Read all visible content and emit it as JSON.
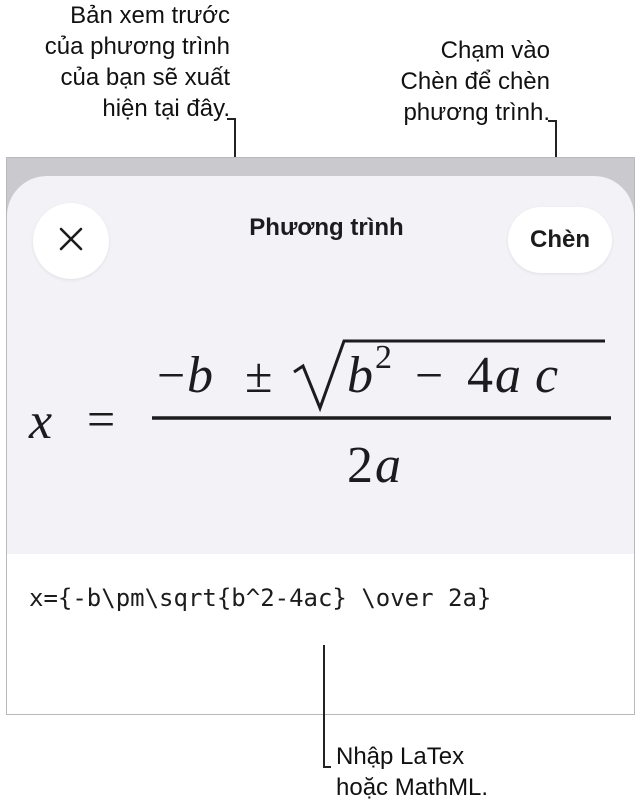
{
  "callouts": {
    "preview_lines": [
      "Bản xem trước",
      "của phương trình",
      "của bạn sẽ xuất",
      "hiện tại đây."
    ],
    "insert_lines": [
      "Chạm vào",
      "Chèn để chèn",
      "phương trình."
    ],
    "input_lines": [
      "Nhập LaTex",
      "hoặc MathML."
    ]
  },
  "sheet": {
    "title": "Phương trình",
    "close_icon": "xmark",
    "insert_label": "Chèn"
  },
  "formula": {
    "lhs": "x",
    "equals": "=",
    "minus": "−",
    "b": "b",
    "plusminus": "±",
    "b_sq": "b",
    "exponent": "2",
    "minus2": "−",
    "four_a_c": "4",
    "a": "a",
    "c": "c",
    "denominator_2": "2",
    "denominator_a": "a"
  },
  "editor": {
    "value": "x={-b\\pm\\sqrt{b^2-4ac} \\over 2a}"
  },
  "colors": {
    "sheet_bg": "#f2f2f7",
    "device_bg": "#c9c9ce",
    "button_bg": "#ffffff",
    "text": "#1c1c1e"
  }
}
